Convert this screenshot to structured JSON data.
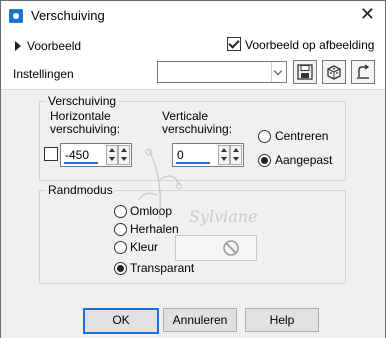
{
  "window": {
    "title": "Verschuiving",
    "close_glyph": "✕"
  },
  "toolbar": {
    "expander_label": "Voorbeeld",
    "preview_on_image_label": "Voorbeeld op afbeelding",
    "preview_on_image_checked": true,
    "settings_label": "Instellingen",
    "preset_value": ""
  },
  "offset_group": {
    "title": "Verschuiving",
    "horizontal_label_1": "Horizontale",
    "horizontal_label_2": "verschuiving:",
    "horizontal_value": "-450",
    "vertical_label_1": "Verticale",
    "vertical_label_2": "verschuiving:",
    "vertical_value": "0",
    "center_label": "Centreren",
    "custom_label": "Aangepast",
    "selected": "custom",
    "link_checked": false
  },
  "edge_group": {
    "title": "Randmodus",
    "options": [
      "Omloop",
      "Herhalen",
      "Kleur",
      "Transparant"
    ],
    "selected": "Transparant"
  },
  "watermark_text": "Sylviane",
  "buttons": {
    "ok": "OK",
    "cancel": "Annuleren",
    "help": "Help"
  },
  "icons": [
    "app-icon",
    "close-icon",
    "save-preset-icon",
    "randomize-icon",
    "reset-icon",
    "no-color-icon"
  ]
}
